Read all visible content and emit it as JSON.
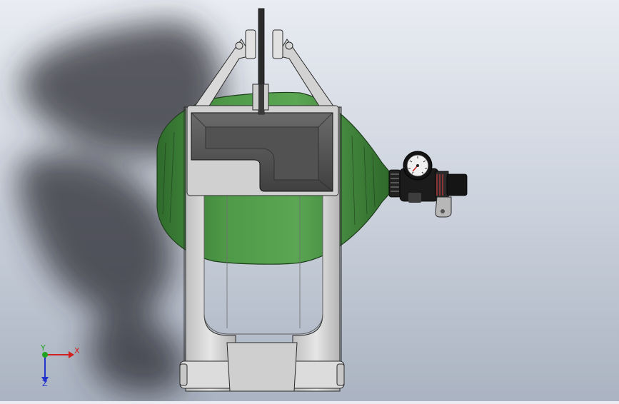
{
  "viewport": {
    "triad": {
      "x_label": "X",
      "y_label": "Y",
      "z_label": "Z",
      "x_color": "#d22020",
      "y_color": "#21a321",
      "z_color": "#2233cc"
    }
  }
}
